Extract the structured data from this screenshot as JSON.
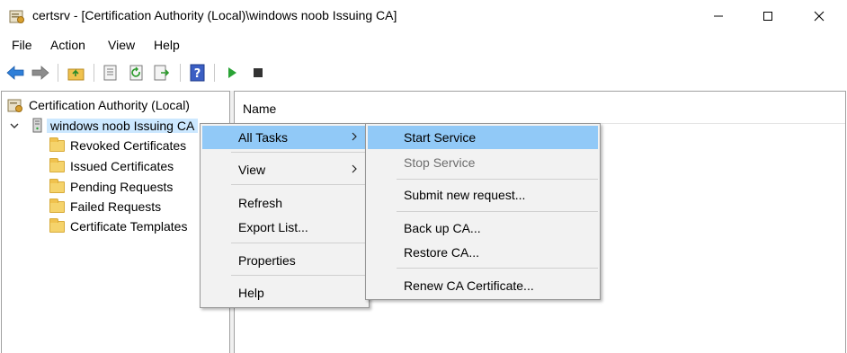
{
  "window": {
    "title": "certsrv - [Certification Authority (Local)\\windows noob Issuing CA]"
  },
  "menubar": {
    "file": "File",
    "action": "Action",
    "view": "View",
    "help": "Help"
  },
  "toolbar": {
    "icons": [
      "back-arrow-icon",
      "forward-arrow-icon",
      "up-folder-icon",
      "properties-icon",
      "refresh-icon",
      "export-list-icon",
      "help-icon",
      "start-service-icon",
      "stop-service-icon"
    ]
  },
  "tree": {
    "root": "Certification Authority (Local)",
    "ca_node": "windows noob Issuing CA",
    "children": [
      "Revoked Certificates",
      "Issued Certificates",
      "Pending Requests",
      "Failed Requests",
      "Certificate Templates"
    ]
  },
  "list": {
    "column_name": "Name"
  },
  "context_menu": {
    "all_tasks": "All Tasks",
    "view": "View",
    "refresh": "Refresh",
    "export_list": "Export List...",
    "properties": "Properties",
    "help": "Help"
  },
  "submenu": {
    "start_service": "Start Service",
    "stop_service": "Stop Service",
    "submit_new_request": "Submit new request...",
    "back_up_ca": "Back up CA...",
    "restore_ca": "Restore CA...",
    "renew_ca_certificate": "Renew CA Certificate..."
  },
  "colors": {
    "highlight": "#91c9f7",
    "selected_node": "#cce8ff",
    "menu_bg": "#f2f2f2",
    "start_green": "#2aa336"
  }
}
